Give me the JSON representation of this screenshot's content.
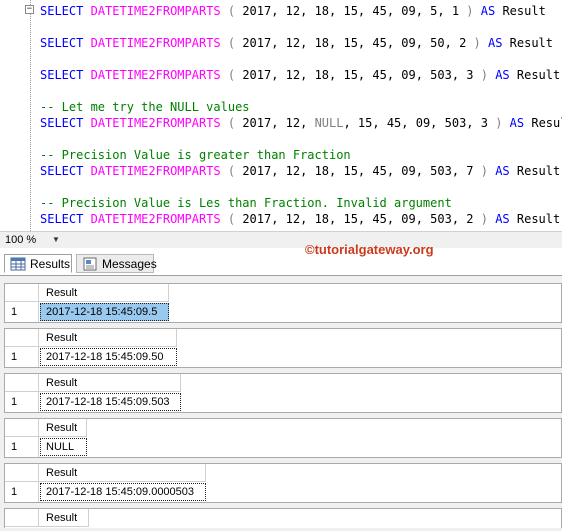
{
  "editor": {
    "line1": {
      "kw1": "SELECT",
      "fn": "DATETIME2FROMPARTS",
      "p1": " ( ",
      "args": "2017, 12, 18, 15, 45, 09, 5, 1",
      "p2": " ) ",
      "kw2": "AS",
      "alias": " Result"
    },
    "line2": {
      "kw1": "SELECT",
      "fn": "DATETIME2FROMPARTS",
      "p1": " ( ",
      "args": "2017, 12, 18, 15, 45, 09, 50, 2",
      "p2": " ) ",
      "kw2": "AS",
      "alias": " Result"
    },
    "line3": {
      "kw1": "SELECT",
      "fn": "DATETIME2FROMPARTS",
      "p1": " ( ",
      "args": "2017, 12, 18, 15, 45, 09, 503, 3",
      "p2": " ) ",
      "kw2": "AS",
      "alias": " Result"
    },
    "comment1": "-- Let me try the NULL values",
    "line4": {
      "kw1": "SELECT",
      "fn": "DATETIME2FROMPARTS",
      "p1": " ( ",
      "args_a": "2017, 12, ",
      "null_kw": "NULL",
      "args_b": ", 15, 45, 09, 503, 3",
      "p2": " ) ",
      "kw2": "AS",
      "alias": " Result"
    },
    "comment2": "-- Precision Value is greater than Fraction",
    "line5": {
      "kw1": "SELECT",
      "fn": "DATETIME2FROMPARTS",
      "p1": " ( ",
      "args": "2017, 12, 18, 15, 45, 09, 503, 7",
      "p2": " ) ",
      "kw2": "AS",
      "alias": " Result"
    },
    "comment3": "-- Precision Value is Les than Fraction. Invalid argument",
    "line6": {
      "kw1": "SELECT",
      "fn": "DATETIME2FROMPARTS",
      "p1": " ( ",
      "args": "2017, 12, 18, 15, 45, 09, 503, 2",
      "p2": " ) ",
      "kw2": "AS",
      "alias": " Result"
    }
  },
  "zoom": {
    "value": "100 %"
  },
  "tabs": {
    "results": "Results",
    "messages": "Messages"
  },
  "watermark": "©tutorialgateway.org",
  "results": [
    {
      "column": "Result",
      "row": "1",
      "value": "2017-12-18 15:45:09.5"
    },
    {
      "column": "Result",
      "row": "1",
      "value": "2017-12-18 15:45:09.50"
    },
    {
      "column": "Result",
      "row": "1",
      "value": "2017-12-18 15:45:09.503"
    },
    {
      "column": "Result",
      "row": "1",
      "value": "NULL"
    },
    {
      "column": "Result",
      "row": "1",
      "value": "2017-12-18 15:45:09.0000503"
    },
    {
      "column": "Result"
    }
  ],
  "colors": {
    "keyword": "#0000ff",
    "function": "#ff00ff",
    "comment": "#008000",
    "selection": "#99c9ef",
    "watermark": "#cc3a1c"
  }
}
